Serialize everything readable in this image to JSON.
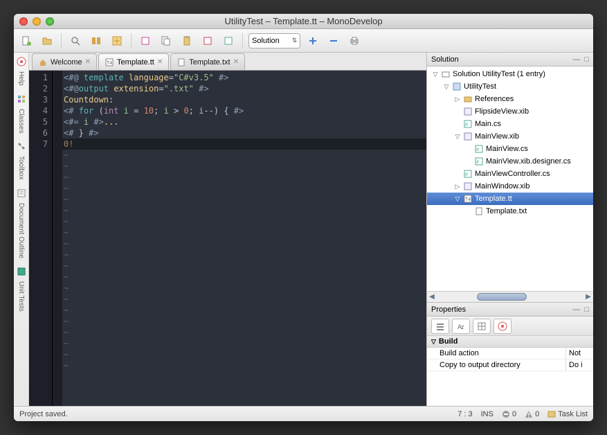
{
  "title": "UtilityTest – Template.tt – MonoDevelop",
  "toolbar": {
    "combo": "Solution"
  },
  "tabs": [
    {
      "label": "Welcome",
      "kind": "welcome",
      "active": false
    },
    {
      "label": "Template.tt",
      "kind": "t4",
      "active": true
    },
    {
      "label": "Template.txt",
      "kind": "txt",
      "active": false
    }
  ],
  "editor": {
    "line_numbers": [
      "1",
      "2",
      "3",
      "4",
      "5",
      "6",
      "7"
    ],
    "tokens": [
      [
        {
          "t": "<#@",
          "c": "dir"
        },
        {
          "t": " ",
          "c": "op"
        },
        {
          "t": "template",
          "c": "key"
        },
        {
          "t": " ",
          "c": "op"
        },
        {
          "t": "language",
          "c": "attr"
        },
        {
          "t": "=",
          "c": "op"
        },
        {
          "t": "\"C#v3.5\"",
          "c": "str"
        },
        {
          "t": " ",
          "c": "op"
        },
        {
          "t": "#>",
          "c": "dir"
        }
      ],
      [
        {
          "t": "<#@",
          "c": "dir"
        },
        {
          "t": "output",
          "c": "key"
        },
        {
          "t": " ",
          "c": "op"
        },
        {
          "t": "extension",
          "c": "attr"
        },
        {
          "t": "=",
          "c": "op"
        },
        {
          "t": "\".txt\"",
          "c": "str"
        },
        {
          "t": " ",
          "c": "op"
        },
        {
          "t": "#>",
          "c": "dir"
        }
      ],
      [
        {
          "t": "Countdown:",
          "c": "txt"
        }
      ],
      [
        {
          "t": "<#",
          "c": "dir"
        },
        {
          "t": " ",
          "c": "op"
        },
        {
          "t": "for",
          "c": "key"
        },
        {
          "t": " (",
          "c": "op"
        },
        {
          "t": "int",
          "c": "type"
        },
        {
          "t": " ",
          "c": "op"
        },
        {
          "t": "i",
          "c": "var"
        },
        {
          "t": " = ",
          "c": "op"
        },
        {
          "t": "10",
          "c": "num"
        },
        {
          "t": "; ",
          "c": "op"
        },
        {
          "t": "i",
          "c": "var"
        },
        {
          "t": " > ",
          "c": "op"
        },
        {
          "t": "0",
          "c": "num"
        },
        {
          "t": "; ",
          "c": "op"
        },
        {
          "t": "i",
          "c": "var"
        },
        {
          "t": "--",
          "c": "op"
        },
        {
          "t": ") { ",
          "c": "op"
        },
        {
          "t": "#>",
          "c": "dir"
        }
      ],
      [
        {
          "t": "<#=",
          "c": "dir"
        },
        {
          "t": " ",
          "c": "op"
        },
        {
          "t": "i",
          "c": "var"
        },
        {
          "t": " ",
          "c": "op"
        },
        {
          "t": "#>",
          "c": "dir"
        },
        {
          "t": "...",
          "c": "txt"
        }
      ],
      [
        {
          "t": "<#",
          "c": "dir"
        },
        {
          "t": " } ",
          "c": "op"
        },
        {
          "t": "#>",
          "c": "dir"
        }
      ],
      [
        {
          "t": "0!",
          "c": "txt"
        }
      ]
    ],
    "highlight_line_index": 6,
    "tilde_count": 20
  },
  "solution": {
    "title": "Solution",
    "root": "Solution UtilityTest (1 entry)",
    "nodes": [
      {
        "depth": 0,
        "exp": "▽",
        "ico": "sln",
        "label": "Solution UtilityTest (1 entry)"
      },
      {
        "depth": 1,
        "exp": "▽",
        "ico": "proj",
        "label": "UtilityTest"
      },
      {
        "depth": 2,
        "exp": "▷",
        "ico": "ref",
        "label": "References"
      },
      {
        "depth": 2,
        "exp": "",
        "ico": "xib",
        "label": "FlipsideView.xib"
      },
      {
        "depth": 2,
        "exp": "",
        "ico": "cs",
        "label": "Main.cs"
      },
      {
        "depth": 2,
        "exp": "▽",
        "ico": "xib",
        "label": "MainView.xib"
      },
      {
        "depth": 3,
        "exp": "",
        "ico": "cs",
        "label": "MainView.cs"
      },
      {
        "depth": 3,
        "exp": "",
        "ico": "cs",
        "label": "MainView.xib.designer.cs"
      },
      {
        "depth": 2,
        "exp": "",
        "ico": "cs",
        "label": "MainViewController.cs"
      },
      {
        "depth": 2,
        "exp": "▷",
        "ico": "xib",
        "label": "MainWindow.xib"
      },
      {
        "depth": 2,
        "exp": "▽",
        "ico": "t4",
        "label": "Template.tt",
        "sel": true
      },
      {
        "depth": 3,
        "exp": "",
        "ico": "txt",
        "label": "Template.txt"
      }
    ]
  },
  "properties": {
    "title": "Properties",
    "category": "Build",
    "rows": [
      {
        "k": "Build action",
        "v": "Not"
      },
      {
        "k": "Copy to output directory",
        "v": "Do i"
      }
    ]
  },
  "leftpads": [
    "Help",
    "Classes",
    "Toolbox",
    "Document Outline",
    "Unit Tests"
  ],
  "status": {
    "msg": "Project saved.",
    "pos": "7 : 3",
    "mode": "INS",
    "err": "0",
    "warn": "0",
    "tasks": "Task List"
  }
}
